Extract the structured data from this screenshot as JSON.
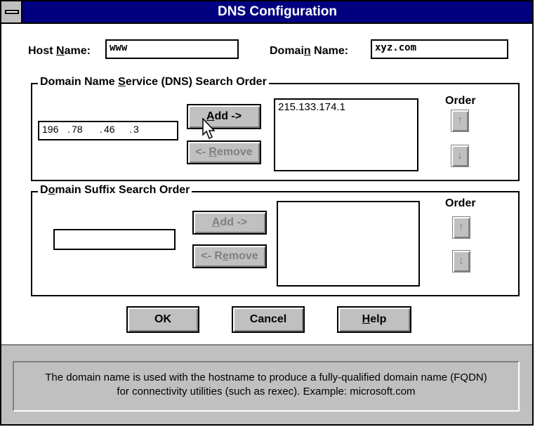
{
  "window": {
    "title": "DNS Configuration"
  },
  "host": {
    "label_pre": "Host ",
    "label_u": "N",
    "label_post": "ame:",
    "value": "www"
  },
  "domain": {
    "label_pre": "Domai",
    "label_u": "n",
    "label_post": " Name:",
    "value": "xyz.com"
  },
  "dns": {
    "legend_pre": "Domain Name ",
    "legend_u": "S",
    "legend_post": "ervice (DNS) Search Order",
    "ip_parts": [
      "196",
      "78",
      "46",
      "3"
    ],
    "add_pre": "",
    "add_u": "A",
    "add_post": "dd ->",
    "remove_pre": "<- ",
    "remove_u": "R",
    "remove_post": "emove",
    "order_label": "Order",
    "list_items": [
      "215.133.174.1"
    ]
  },
  "suffix": {
    "legend_pre": "D",
    "legend_u": "o",
    "legend_post": "main Suffix Search Order",
    "input_value": "",
    "add_pre": "",
    "add_u": "A",
    "add_post": "dd ->",
    "remove_pre": "<- R",
    "remove_u": "e",
    "remove_post": "move",
    "order_label": "Order",
    "list_items": []
  },
  "buttons": {
    "ok": "OK",
    "cancel": "Cancel",
    "help_u": "H",
    "help_post": "elp"
  },
  "status": {
    "line1": "The domain name is used with the hostname to produce a fully-qualified domain name (FQDN)",
    "line2": "for connectivity utilities (such as rexec). Example: microsoft.com"
  },
  "icons": {
    "up": "arrow-up-icon",
    "down": "arrow-down-icon",
    "cursor": "mouse-cursor-icon"
  }
}
